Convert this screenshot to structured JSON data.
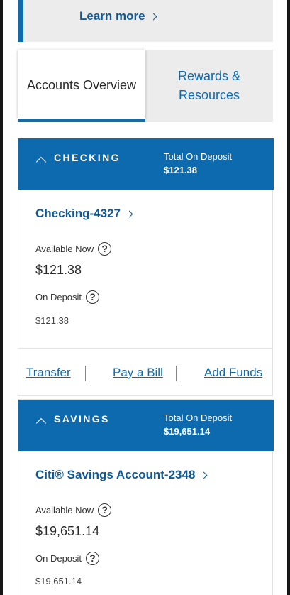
{
  "promo": {
    "learn_more": "Learn more"
  },
  "tabs": [
    {
      "label": "Accounts Overview",
      "active": true
    },
    {
      "label_line1": "Rewards &",
      "label_line2": "Resources",
      "active": false
    }
  ],
  "checking": {
    "section_title": "CHECKING",
    "total_label": "Total On Deposit",
    "total_value": "$121.38",
    "account_name": "Checking-4327",
    "available_label": "Available Now",
    "available_value": "$121.38",
    "on_deposit_label": "On Deposit",
    "on_deposit_value": "$121.38",
    "actions": [
      "Transfer",
      "Pay a Bill",
      "Add Funds"
    ]
  },
  "savings": {
    "section_title": "SAVINGS",
    "total_label": "Total On Deposit",
    "total_value": "$19,651.14",
    "account_name": "Citi® Savings Account-2348",
    "available_label": "Available Now",
    "available_value": "$19,651.14",
    "on_deposit_label": "On Deposit",
    "on_deposit_value": "$19,651.14"
  },
  "help_glyph": "?",
  "colors": {
    "brand_blue": "#0e6aae",
    "link_blue": "#0f5a96",
    "panel_gray": "#ececec"
  },
  "icons": [
    "chevron-right-icon",
    "caret-up-icon",
    "help-circle-icon"
  ]
}
